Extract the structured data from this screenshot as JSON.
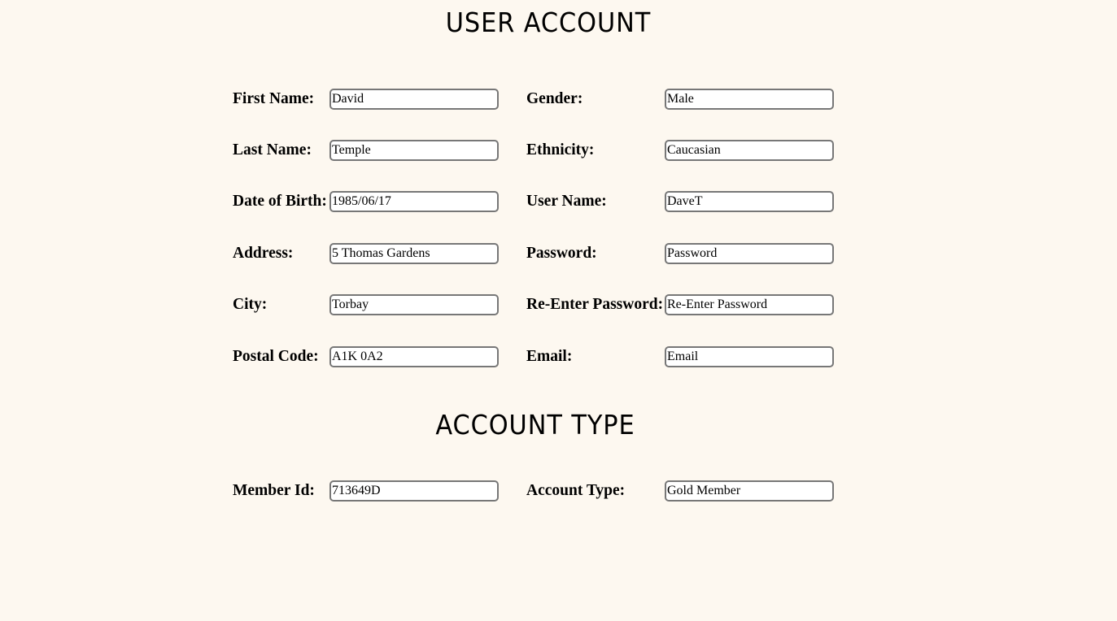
{
  "user_account": {
    "title": "USER ACCOUNT",
    "left_fields": [
      {
        "label": "First Name:",
        "value": "David"
      },
      {
        "label": "Last Name:",
        "value": "Temple"
      },
      {
        "label": "Date of Birth:",
        "value": "1985/06/17"
      },
      {
        "label": "Address:",
        "value": "5 Thomas Gardens"
      },
      {
        "label": "City:",
        "value": "Torbay"
      },
      {
        "label": "Postal Code:",
        "value": "A1K 0A2"
      }
    ],
    "right_fields": [
      {
        "label": "Gender:",
        "value": "Male"
      },
      {
        "label": "Ethnicity:",
        "value": "Caucasian"
      },
      {
        "label": "User Name:",
        "value": "DaveT"
      },
      {
        "label": "Password:",
        "value": "Password"
      },
      {
        "label": "Re-Enter Password:",
        "value": "Re-Enter Password"
      },
      {
        "label": "Email:",
        "value": "Email"
      }
    ]
  },
  "account_type": {
    "title": "ACCOUNT TYPE",
    "left_fields": [
      {
        "label": "Member Id:",
        "value": "713649D"
      }
    ],
    "right_fields": [
      {
        "label": "Account Type:",
        "value": "Gold Member"
      }
    ]
  }
}
